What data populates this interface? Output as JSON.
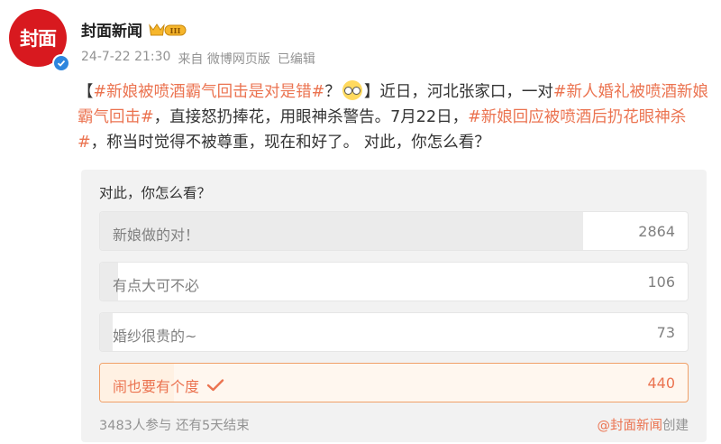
{
  "account": {
    "avatar_text": "封面",
    "name": "封面新闻",
    "badge": "III",
    "verified_icon": "check-icon",
    "brand_color": "#d8191f"
  },
  "meta": {
    "time": "24-7-22 21:30",
    "source": "来自 微博网页版",
    "edited": "已编辑"
  },
  "post": {
    "segments": [
      {
        "text": "【",
        "tag": false
      },
      {
        "text": "#新娘被喷酒霸气回击是对是错#",
        "tag": true
      },
      {
        "text": "？",
        "tag": false
      },
      {
        "emoji": "dizzy-face"
      },
      {
        "text": "】近日，河北张家口，一对",
        "tag": false
      },
      {
        "text": "#新人婚礼被喷酒新娘霸气回击#",
        "tag": true
      },
      {
        "text": "，直接怒扔捧花，用眼神杀警告。7月22日，",
        "tag": false
      },
      {
        "text": "#新娘回应被喷酒后扔花眼神杀#",
        "tag": true
      },
      {
        "text": "，称当时觉得不被尊重，现在和好了。 对此，你怎么看？",
        "tag": false
      }
    ]
  },
  "poll": {
    "title": "对此，你怎么看？",
    "options": [
      {
        "label": "新娘做的对！",
        "count": "2864",
        "share": 0.8223,
        "selected": false
      },
      {
        "label": "有点大可不必",
        "count": "106",
        "share": 0.0304,
        "selected": false
      },
      {
        "label": "婚纱很贵的~",
        "count": "73",
        "share": 0.021,
        "selected": false
      },
      {
        "label": "闹也要有个度",
        "count": "440",
        "share": 0.1263,
        "selected": true
      }
    ],
    "participants": "3483人参与 还有5天结束",
    "creator": "@封面新闻",
    "creator_suffix": "创建",
    "accent_color": "#eb7350"
  }
}
